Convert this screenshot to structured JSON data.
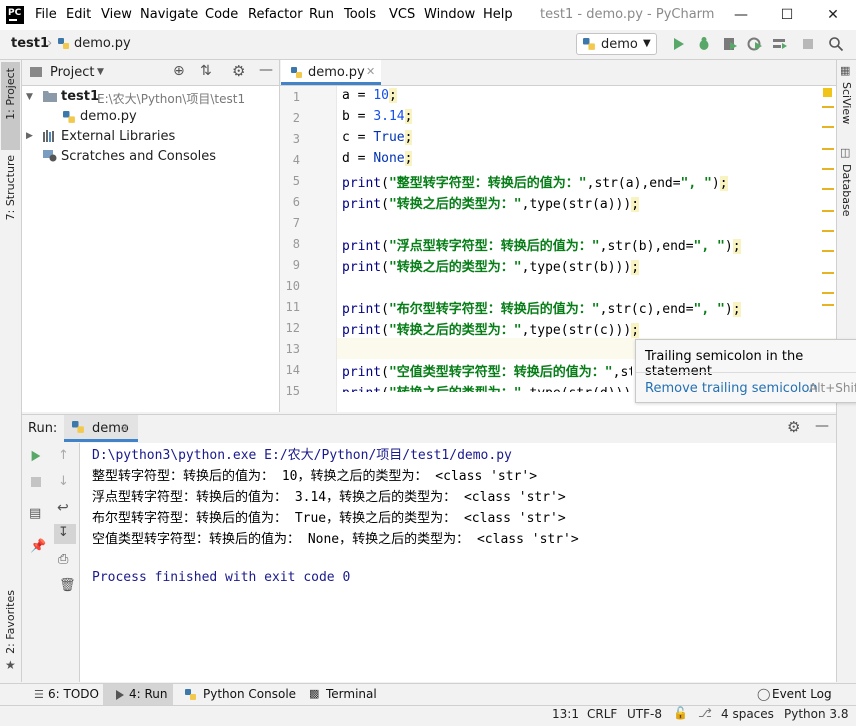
{
  "window": {
    "title": "test1 - demo.py - PyCharm",
    "logo_text": "PC",
    "menu": [
      "File",
      "Edit",
      "View",
      "Navigate",
      "Code",
      "Refactor",
      "Run",
      "Tools",
      "VCS",
      "Window",
      "Help"
    ]
  },
  "breadcrumb": {
    "project": "test1",
    "file": "demo.py"
  },
  "run_config": {
    "selected": "demo"
  },
  "left_tabs": {
    "project": "1: Project",
    "structure": "7: Structure",
    "favorites": "2: Favorites"
  },
  "right_tabs": {
    "sciview": "SciView",
    "database": "Database"
  },
  "project_panel": {
    "title": "Project",
    "tree": [
      {
        "label": "test1",
        "path": "E:\\农大\\Python\\项目\\test1"
      },
      {
        "label": "demo.py"
      },
      {
        "label": "External Libraries"
      },
      {
        "label": "Scratches and Consoles"
      }
    ]
  },
  "editor": {
    "tab_label": "demo.py",
    "line_numbers": [
      "1",
      "2",
      "3",
      "4",
      "5",
      "6",
      "7",
      "8",
      "9",
      "10",
      "11",
      "12",
      "13",
      "14",
      "15"
    ]
  },
  "tooltip": {
    "message": "Trailing semicolon in the statement",
    "fix": "Remove trailing semicolon",
    "shortcut": "Alt+Shift"
  },
  "run_panel": {
    "label": "Run:",
    "tab": "demo",
    "console": [
      "D:\\python3\\python.exe E:/农大/Python/项目/test1/demo.py",
      "整型转字符型：转换后的值为： 10，转换之后的类型为： <class 'str'>",
      "浮点型转字符型：转换后的值为： 3.14，转换之后的类型为： <class 'str'>",
      "布尔型转字符型：转换后的值为： True，转换之后的类型为： <class 'str'>",
      "空值类型转字符型：转换后的值为： None，转换之后的类型为： <class 'str'>",
      "",
      "Process finished with exit code 0"
    ]
  },
  "bottom_tabs": {
    "todo": "6: TODO",
    "run": "4: Run",
    "python_console": "Python Console",
    "terminal": "Terminal",
    "event_log": "Event Log"
  },
  "status": {
    "position": "13:1",
    "line_sep": "CRLF",
    "encoding": "UTF-8",
    "indent": "4 spaces",
    "interpreter": "Python 3.8"
  },
  "colors": {
    "accent": "#4083c9",
    "run_green": "#59a869",
    "string": "#067d17",
    "number": "#1750eb"
  }
}
